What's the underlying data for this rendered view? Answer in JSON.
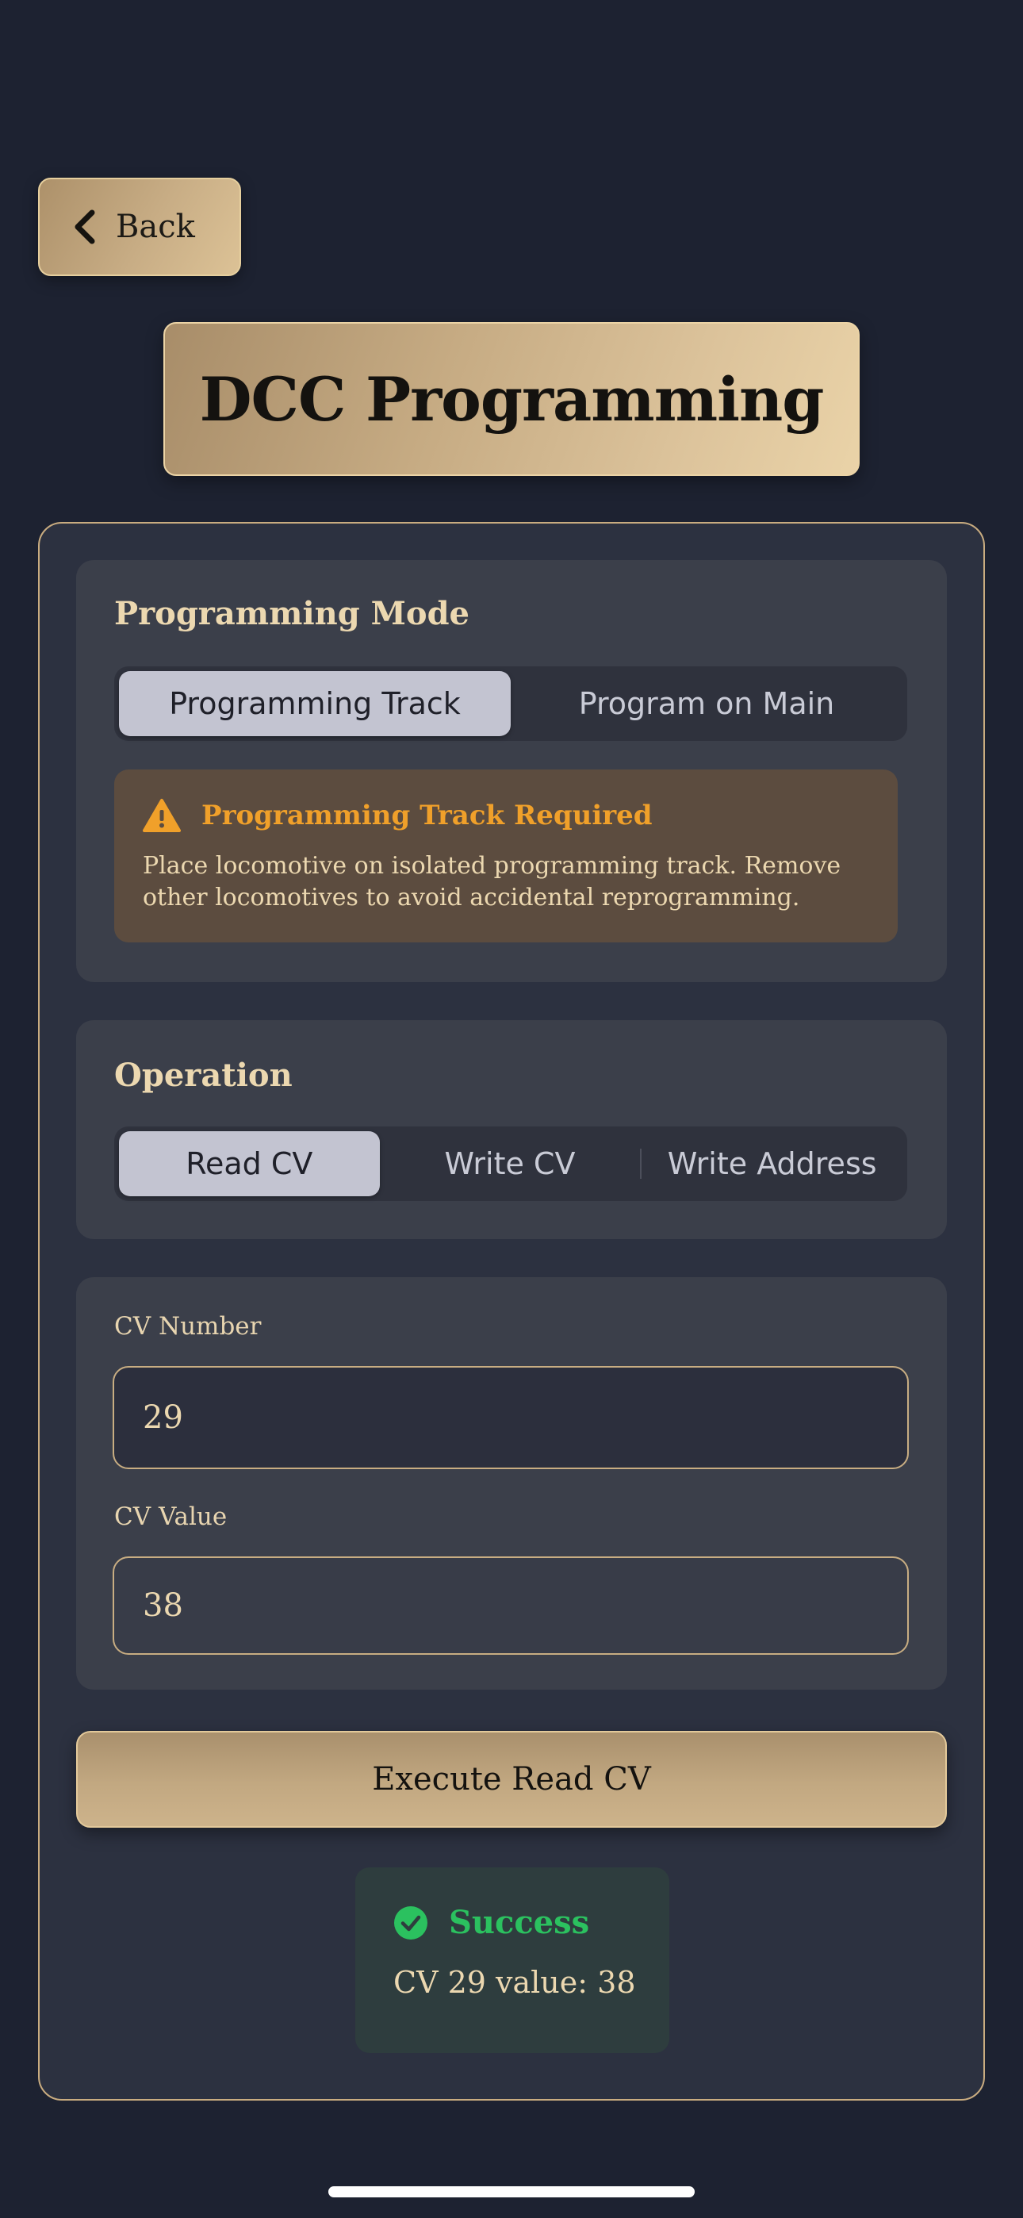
{
  "header": {
    "back_label": "Back",
    "title": "DCC Programming"
  },
  "programming_mode": {
    "title": "Programming Mode",
    "options": [
      "Programming Track",
      "Program on Main"
    ],
    "selected": "Programming Track",
    "warning": {
      "icon": "warning-triangle-icon",
      "title": "Programming Track Required",
      "body": "Place locomotive on isolated programming track. Remove other locomotives to avoid accidental reprogramming."
    }
  },
  "operation": {
    "title": "Operation",
    "options": [
      "Read CV",
      "Write CV",
      "Write Address"
    ],
    "selected": "Read CV"
  },
  "cv": {
    "number_label": "CV Number",
    "number_value": "29",
    "value_label": "CV Value",
    "value_value": "38"
  },
  "execute": {
    "label": "Execute Read CV"
  },
  "result": {
    "icon": "check-circle-icon",
    "title": "Success",
    "message": "CV 29 value: 38"
  },
  "colors": {
    "background": "#1d2231",
    "panel": "#2c3140",
    "card": "#3b3f4a",
    "accent_gold": "#c8ad82",
    "warning": "#f0a02a",
    "success": "#2bc15f"
  }
}
